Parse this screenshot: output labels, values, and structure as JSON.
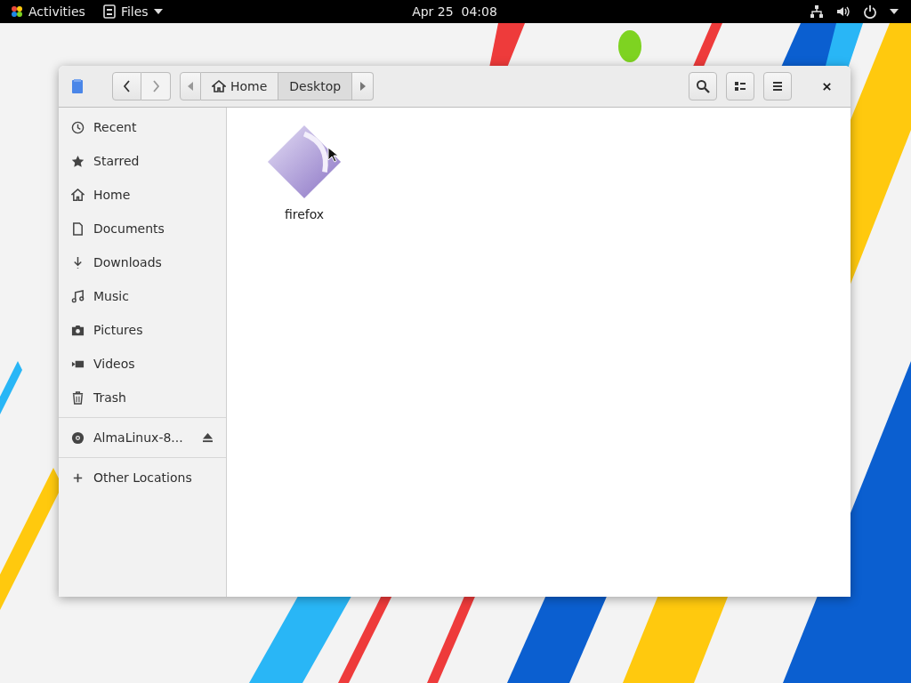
{
  "top_bar": {
    "activities": "Activities",
    "app_menu": "Files",
    "clock": "Apr 25  04:08"
  },
  "window": {
    "nav": [
      {
        "kind": "back",
        "disabled": false
      },
      {
        "kind": "forward",
        "disabled": true
      }
    ],
    "path": [
      {
        "label": "Home",
        "kind": "home",
        "selected": false
      },
      {
        "label": "Desktop",
        "kind": "folder",
        "selected": true
      }
    ],
    "sidebar": {
      "places": [
        "Recent",
        "Starred",
        "Home",
        "Documents",
        "Downloads",
        "Music",
        "Pictures",
        "Videos",
        "Trash"
      ],
      "devices": [
        "AlmaLinux-8..."
      ],
      "other": [
        "Other Locations"
      ]
    },
    "files": [
      {
        "name": "firefox"
      }
    ]
  }
}
